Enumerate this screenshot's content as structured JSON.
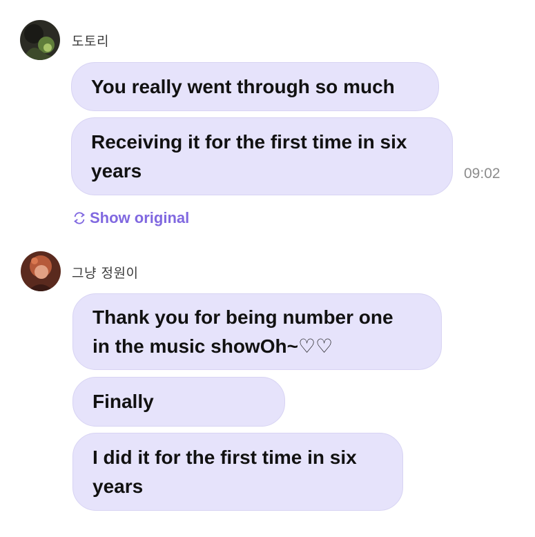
{
  "messages_group_1": {
    "sender": "도토리",
    "avatar_icon": "profile-photo-icon",
    "bubbles": [
      "You really went through so much",
      "Receiving it for the first time in six\nyears"
    ],
    "time": "09:02",
    "show_original_label": "Show original",
    "show_original_icon": "translate-icon"
  },
  "messages_group_2": {
    "sender": "그냥 정원이",
    "avatar_icon": "profile-photo-icon",
    "bubbles": [
      "Thank you for being number one\nin the music showOh~♡♡",
      "Finally",
      "I did it for the first time in six\nyears"
    ]
  },
  "colors": {
    "bubble_bg": "#e6e3fb",
    "accent": "#8068e0",
    "timestamp": "#8c8c8c"
  }
}
